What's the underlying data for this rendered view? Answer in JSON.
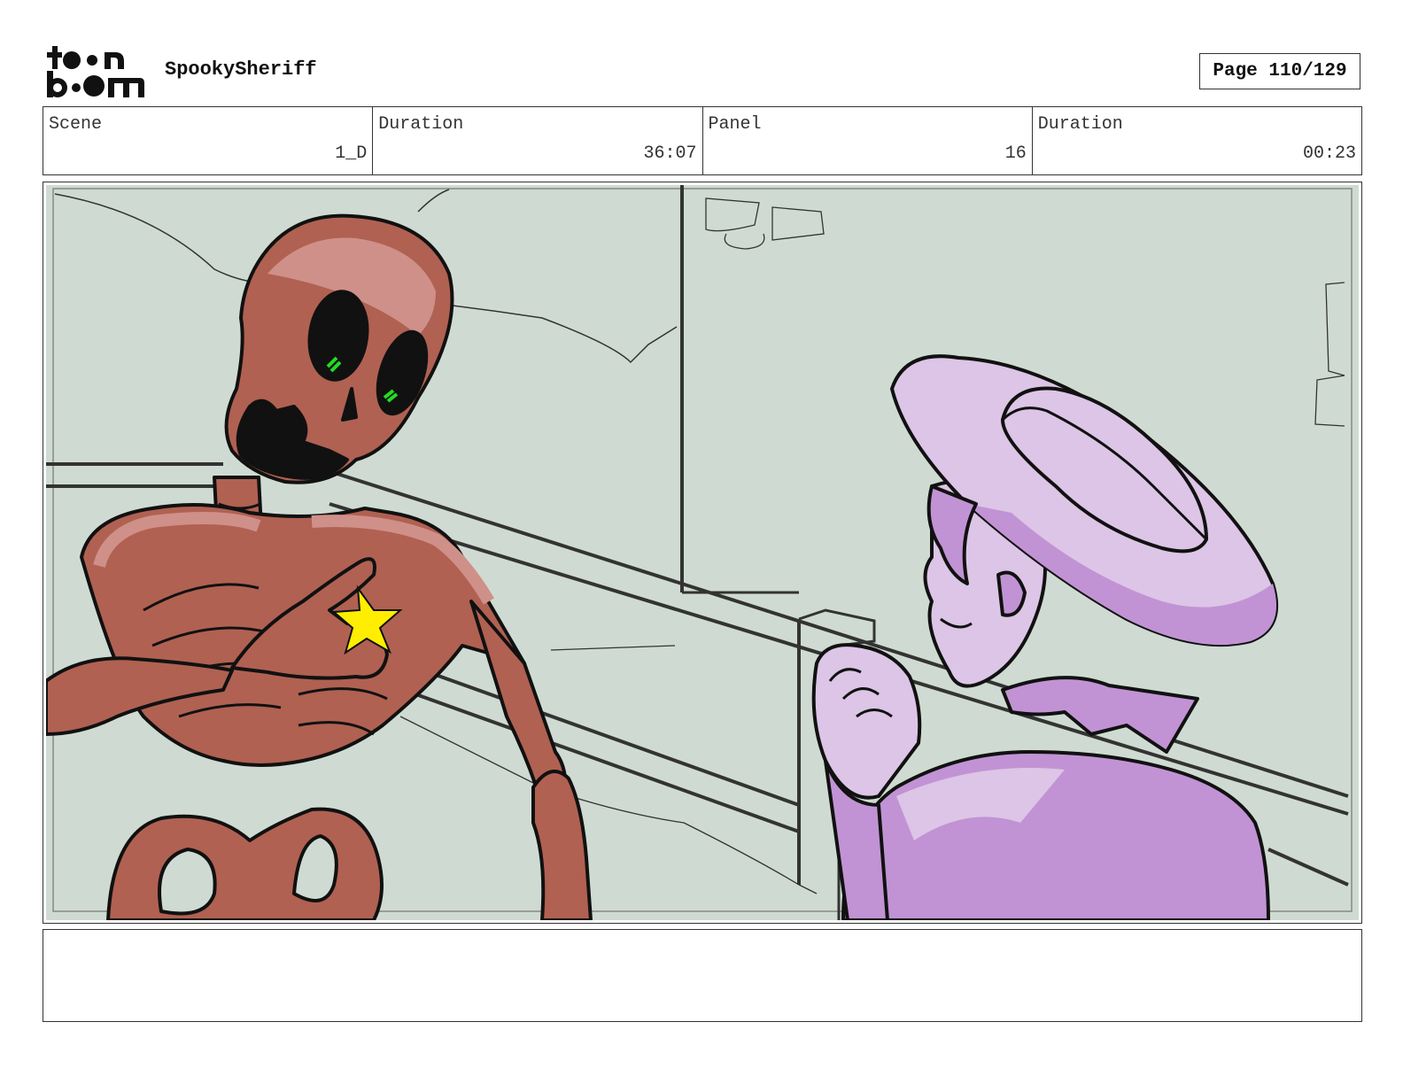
{
  "header": {
    "logo_text": "toon boom",
    "project_title": "SpookySheriff",
    "page_label": "Page 110/129"
  },
  "info": [
    {
      "label": "Scene",
      "value": "1_D"
    },
    {
      "label": "Duration",
      "value": "36:07"
    },
    {
      "label": "Panel",
      "value": "16"
    },
    {
      "label": "Duration",
      "value": "00:23"
    }
  ],
  "panel": {
    "description": "",
    "colors": {
      "background": "#cfdbd2",
      "skeleton": "#b06152",
      "skeleton_highlight": "#cf9089",
      "sheriff": "#c193d4",
      "sheriff_light": "#dcc5e6",
      "star": "#ffee00",
      "eye_glow": "#22dd22",
      "ink": "#111111"
    }
  },
  "notes": {
    "text": ""
  }
}
